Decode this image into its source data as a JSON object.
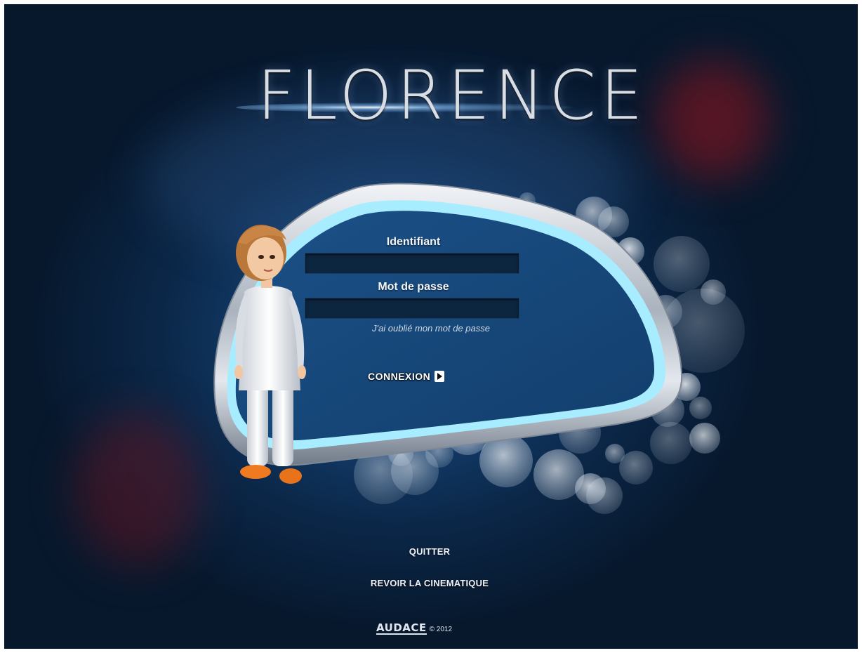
{
  "app": {
    "logo_text": "FLORENCE",
    "colors": {
      "background_center": "#1b4f86",
      "background_edge": "#07182d",
      "panel_fill": "#184a80",
      "frame_silver": "#c8ced6",
      "frame_glow": "#9fe8ff",
      "text": "#f2f4f8"
    }
  },
  "login": {
    "username_label": "Identifiant",
    "username_value": "",
    "password_label": "Mot de passe",
    "password_value": "",
    "forgot_password_link": "J'ai oublié mon mot de passe",
    "submit_label": "CONNEXION",
    "submit_icon": "play-arrow-icon"
  },
  "menu": {
    "quit_label": "QUITTER",
    "replay_cinematic_label": "REVOIR LA CINEMATIQUE"
  },
  "footer": {
    "brand": "AUDACE",
    "copyright": "© 2012"
  },
  "decor": {
    "character": "nurse-character",
    "bubbles_icon": "bokeh-bubbles"
  }
}
